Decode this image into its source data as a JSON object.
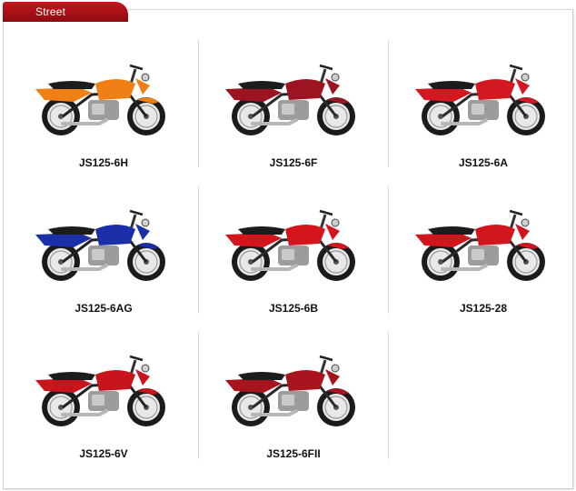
{
  "header": {
    "tab_label": "Street"
  },
  "models": [
    {
      "name": "JS125-6H",
      "color": "#f07f16",
      "accent": "#222222"
    },
    {
      "name": "JS125-6F",
      "color": "#9c1422",
      "accent": "#2a2a2a"
    },
    {
      "name": "JS125-6A",
      "color": "#d21820",
      "accent": "#2a2a2a"
    },
    {
      "name": "JS125-6AG",
      "color": "#1a2fa8",
      "accent": "#222222"
    },
    {
      "name": "JS125-6B",
      "color": "#d4161c",
      "accent": "#2a2a2a"
    },
    {
      "name": "JS125-28",
      "color": "#d0161c",
      "accent": "#2a2a2a"
    },
    {
      "name": "JS125-6V",
      "color": "#c8141c",
      "accent": "#222222"
    },
    {
      "name": "JS125-6FII",
      "color": "#a8141e",
      "accent": "#2a2a2a"
    }
  ]
}
